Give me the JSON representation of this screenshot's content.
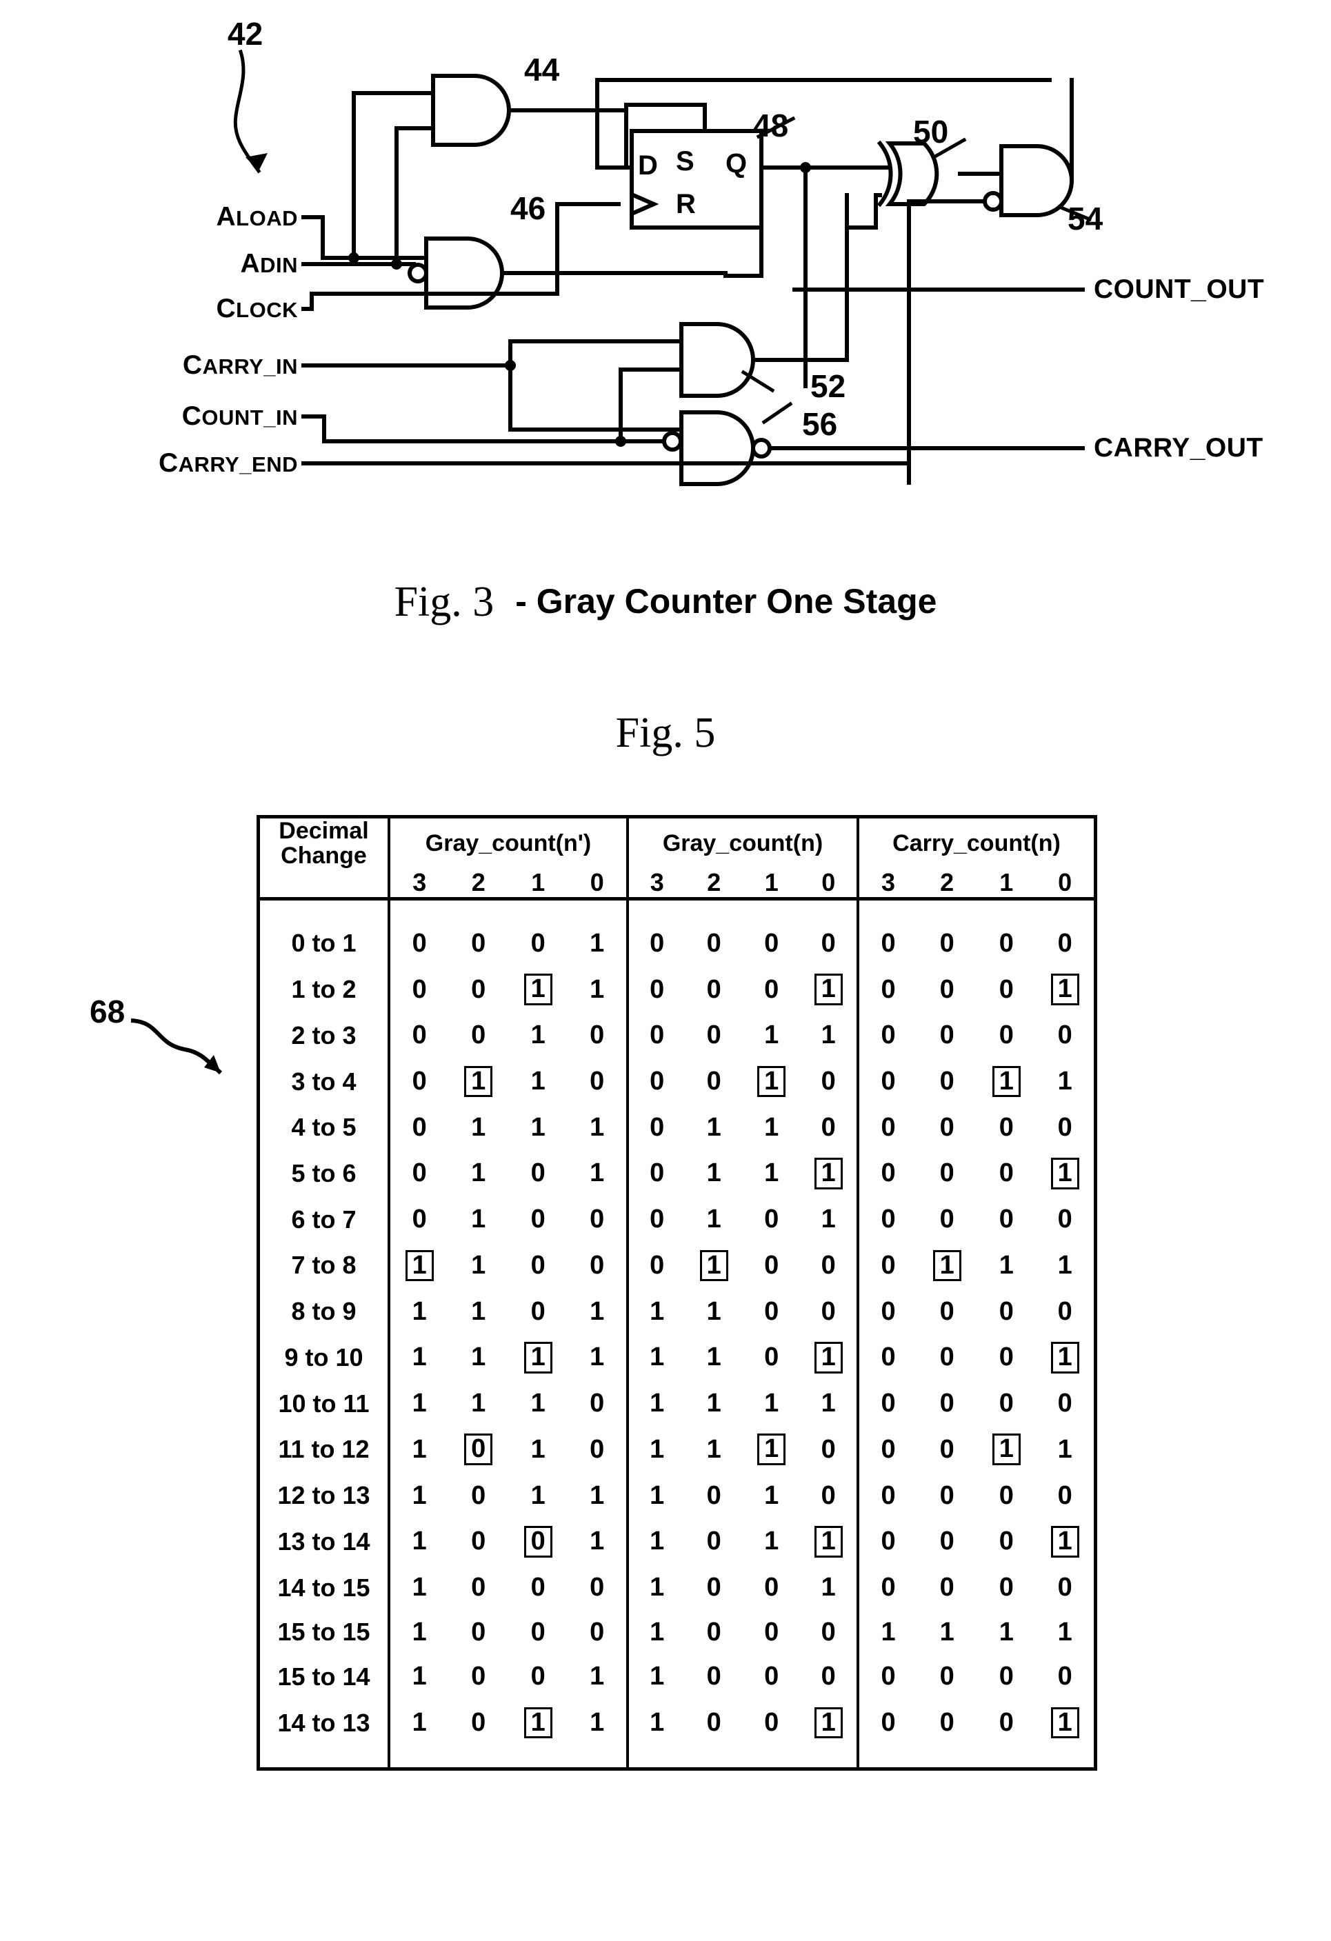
{
  "figure3": {
    "ref": "42",
    "caption_prefix": "Fig. 3",
    "caption_text": "- Gray Counter One Stage",
    "inputs": [
      {
        "name": "ALOAD",
        "first": "A",
        "rest": "LOAD"
      },
      {
        "name": "ADIN",
        "first": "A",
        "rest": "DIN"
      },
      {
        "name": "CLOCK",
        "first": "C",
        "rest": "LOCK"
      },
      {
        "name": "CARRY_IN",
        "first": "C",
        "rest": "ARRY_IN"
      },
      {
        "name": "COUNT_IN",
        "first": "C",
        "rest": "OUNT_IN"
      },
      {
        "name": "CARRY_END",
        "first": "C",
        "rest": "ARRY_END"
      }
    ],
    "outputs": [
      {
        "name": "COUNT_OUT"
      },
      {
        "name": "CARRY_OUT"
      }
    ],
    "gate_refs": [
      "44",
      "46",
      "48",
      "50",
      "52",
      "54",
      "56"
    ],
    "flipflop_pins": [
      "D",
      "S",
      "Q",
      "R"
    ]
  },
  "figure5": {
    "caption": "Fig. 5",
    "ref": "68",
    "table": {
      "col_headers": [
        "Decimal Change",
        "Gray_count(n')",
        "Gray_count(n)",
        "Carry_count(n)"
      ],
      "header_line1": [
        "Decimal",
        "Gray_count(n')",
        "Gray_count(n)",
        "Carry_count(n)"
      ],
      "header_line2": [
        "Change",
        "",
        "",
        ""
      ],
      "bit_headers": [
        "3",
        "2",
        "1",
        "0"
      ],
      "rows": [
        {
          "change": "0 to 1",
          "gray_np": [
            "0",
            "0",
            "0",
            "1"
          ],
          "gray_np_box": [
            false,
            false,
            false,
            false
          ],
          "gray_n": [
            "0",
            "0",
            "0",
            "0"
          ],
          "gray_n_box": [
            false,
            false,
            false,
            false
          ],
          "carry_n": [
            "0",
            "0",
            "0",
            "0"
          ],
          "carry_n_box": [
            false,
            false,
            false,
            false
          ]
        },
        {
          "change": "1 to 2",
          "gray_np": [
            "0",
            "0",
            "1",
            "1"
          ],
          "gray_np_box": [
            false,
            false,
            true,
            false
          ],
          "gray_n": [
            "0",
            "0",
            "0",
            "1"
          ],
          "gray_n_box": [
            false,
            false,
            false,
            true
          ],
          "carry_n": [
            "0",
            "0",
            "0",
            "1"
          ],
          "carry_n_box": [
            false,
            false,
            false,
            true
          ]
        },
        {
          "change": "2 to 3",
          "gray_np": [
            "0",
            "0",
            "1",
            "0"
          ],
          "gray_np_box": [
            false,
            false,
            false,
            false
          ],
          "gray_n": [
            "0",
            "0",
            "1",
            "1"
          ],
          "gray_n_box": [
            false,
            false,
            false,
            false
          ],
          "carry_n": [
            "0",
            "0",
            "0",
            "0"
          ],
          "carry_n_box": [
            false,
            false,
            false,
            false
          ]
        },
        {
          "change": "3 to 4",
          "gray_np": [
            "0",
            "1",
            "1",
            "0"
          ],
          "gray_np_box": [
            false,
            true,
            false,
            false
          ],
          "gray_n": [
            "0",
            "0",
            "1",
            "0"
          ],
          "gray_n_box": [
            false,
            false,
            true,
            false
          ],
          "carry_n": [
            "0",
            "0",
            "1",
            "1"
          ],
          "carry_n_box": [
            false,
            false,
            true,
            false
          ]
        },
        {
          "change": "4 to 5",
          "gray_np": [
            "0",
            "1",
            "1",
            "1"
          ],
          "gray_np_box": [
            false,
            false,
            false,
            false
          ],
          "gray_n": [
            "0",
            "1",
            "1",
            "0"
          ],
          "gray_n_box": [
            false,
            false,
            false,
            false
          ],
          "carry_n": [
            "0",
            "0",
            "0",
            "0"
          ],
          "carry_n_box": [
            false,
            false,
            false,
            false
          ]
        },
        {
          "change": "5 to 6",
          "gray_np": [
            "0",
            "1",
            "0",
            "1"
          ],
          "gray_np_box": [
            false,
            false,
            false,
            false
          ],
          "gray_n": [
            "0",
            "1",
            "1",
            "1"
          ],
          "gray_n_box": [
            false,
            false,
            false,
            true
          ],
          "carry_n": [
            "0",
            "0",
            "0",
            "1"
          ],
          "carry_n_box": [
            false,
            false,
            false,
            true
          ]
        },
        {
          "change": "6 to 7",
          "gray_np": [
            "0",
            "1",
            "0",
            "0"
          ],
          "gray_np_box": [
            false,
            false,
            false,
            false
          ],
          "gray_n": [
            "0",
            "1",
            "0",
            "1"
          ],
          "gray_n_box": [
            false,
            false,
            false,
            false
          ],
          "carry_n": [
            "0",
            "0",
            "0",
            "0"
          ],
          "carry_n_box": [
            false,
            false,
            false,
            false
          ]
        },
        {
          "change": "7 to 8",
          "gray_np": [
            "1",
            "1",
            "0",
            "0"
          ],
          "gray_np_box": [
            true,
            false,
            false,
            false
          ],
          "gray_n": [
            "0",
            "1",
            "0",
            "0"
          ],
          "gray_n_box": [
            false,
            true,
            false,
            false
          ],
          "carry_n": [
            "0",
            "1",
            "1",
            "1"
          ],
          "carry_n_box": [
            false,
            true,
            false,
            false
          ]
        },
        {
          "change": "8 to 9",
          "gray_np": [
            "1",
            "1",
            "0",
            "1"
          ],
          "gray_np_box": [
            false,
            false,
            false,
            false
          ],
          "gray_n": [
            "1",
            "1",
            "0",
            "0"
          ],
          "gray_n_box": [
            false,
            false,
            false,
            false
          ],
          "carry_n": [
            "0",
            "0",
            "0",
            "0"
          ],
          "carry_n_box": [
            false,
            false,
            false,
            false
          ]
        },
        {
          "change": "9 to 10",
          "gray_np": [
            "1",
            "1",
            "1",
            "1"
          ],
          "gray_np_box": [
            false,
            false,
            true,
            false
          ],
          "gray_n": [
            "1",
            "1",
            "0",
            "1"
          ],
          "gray_n_box": [
            false,
            false,
            false,
            true
          ],
          "carry_n": [
            "0",
            "0",
            "0",
            "1"
          ],
          "carry_n_box": [
            false,
            false,
            false,
            true
          ]
        },
        {
          "change": "10 to 11",
          "gray_np": [
            "1",
            "1",
            "1",
            "0"
          ],
          "gray_np_box": [
            false,
            false,
            false,
            false
          ],
          "gray_n": [
            "1",
            "1",
            "1",
            "1"
          ],
          "gray_n_box": [
            false,
            false,
            false,
            false
          ],
          "carry_n": [
            "0",
            "0",
            "0",
            "0"
          ],
          "carry_n_box": [
            false,
            false,
            false,
            false
          ]
        },
        {
          "change": "11 to 12",
          "gray_np": [
            "1",
            "0",
            "1",
            "0"
          ],
          "gray_np_box": [
            false,
            true,
            false,
            false
          ],
          "gray_n": [
            "1",
            "1",
            "1",
            "0"
          ],
          "gray_n_box": [
            false,
            false,
            true,
            false
          ],
          "carry_n": [
            "0",
            "0",
            "1",
            "1"
          ],
          "carry_n_box": [
            false,
            false,
            true,
            false
          ]
        },
        {
          "change": "12 to 13",
          "gray_np": [
            "1",
            "0",
            "1",
            "1"
          ],
          "gray_np_box": [
            false,
            false,
            false,
            false
          ],
          "gray_n": [
            "1",
            "0",
            "1",
            "0"
          ],
          "gray_n_box": [
            false,
            false,
            false,
            false
          ],
          "carry_n": [
            "0",
            "0",
            "0",
            "0"
          ],
          "carry_n_box": [
            false,
            false,
            false,
            false
          ]
        },
        {
          "change": "13 to 14",
          "gray_np": [
            "1",
            "0",
            "0",
            "1"
          ],
          "gray_np_box": [
            false,
            false,
            true,
            false
          ],
          "gray_n": [
            "1",
            "0",
            "1",
            "1"
          ],
          "gray_n_box": [
            false,
            false,
            false,
            true
          ],
          "carry_n": [
            "0",
            "0",
            "0",
            "1"
          ],
          "carry_n_box": [
            false,
            false,
            false,
            true
          ]
        },
        {
          "change": "14 to 15",
          "gray_np": [
            "1",
            "0",
            "0",
            "0"
          ],
          "gray_np_box": [
            false,
            false,
            false,
            false
          ],
          "gray_n": [
            "1",
            "0",
            "0",
            "1"
          ],
          "gray_n_box": [
            false,
            false,
            false,
            false
          ],
          "carry_n": [
            "0",
            "0",
            "0",
            "0"
          ],
          "carry_n_box": [
            false,
            false,
            false,
            false
          ]
        },
        {
          "change": "15 to 15",
          "gray_np": [
            "1",
            "0",
            "0",
            "0"
          ],
          "gray_np_box": [
            false,
            false,
            false,
            false
          ],
          "gray_n": [
            "1",
            "0",
            "0",
            "0"
          ],
          "gray_n_box": [
            false,
            false,
            false,
            false
          ],
          "carry_n": [
            "1",
            "1",
            "1",
            "1"
          ],
          "carry_n_box": [
            false,
            false,
            false,
            false
          ]
        },
        {
          "change": "15 to 14",
          "gray_np": [
            "1",
            "0",
            "0",
            "1"
          ],
          "gray_np_box": [
            false,
            false,
            false,
            false
          ],
          "gray_n": [
            "1",
            "0",
            "0",
            "0"
          ],
          "gray_n_box": [
            false,
            false,
            false,
            false
          ],
          "carry_n": [
            "0",
            "0",
            "0",
            "0"
          ],
          "carry_n_box": [
            false,
            false,
            false,
            false
          ]
        },
        {
          "change": "14 to 13",
          "gray_np": [
            "1",
            "0",
            "1",
            "1"
          ],
          "gray_np_box": [
            false,
            false,
            true,
            false
          ],
          "gray_n": [
            "1",
            "0",
            "0",
            "1"
          ],
          "gray_n_box": [
            false,
            false,
            false,
            true
          ],
          "carry_n": [
            "0",
            "0",
            "0",
            "1"
          ],
          "carry_n_box": [
            false,
            false,
            false,
            true
          ]
        }
      ]
    }
  }
}
